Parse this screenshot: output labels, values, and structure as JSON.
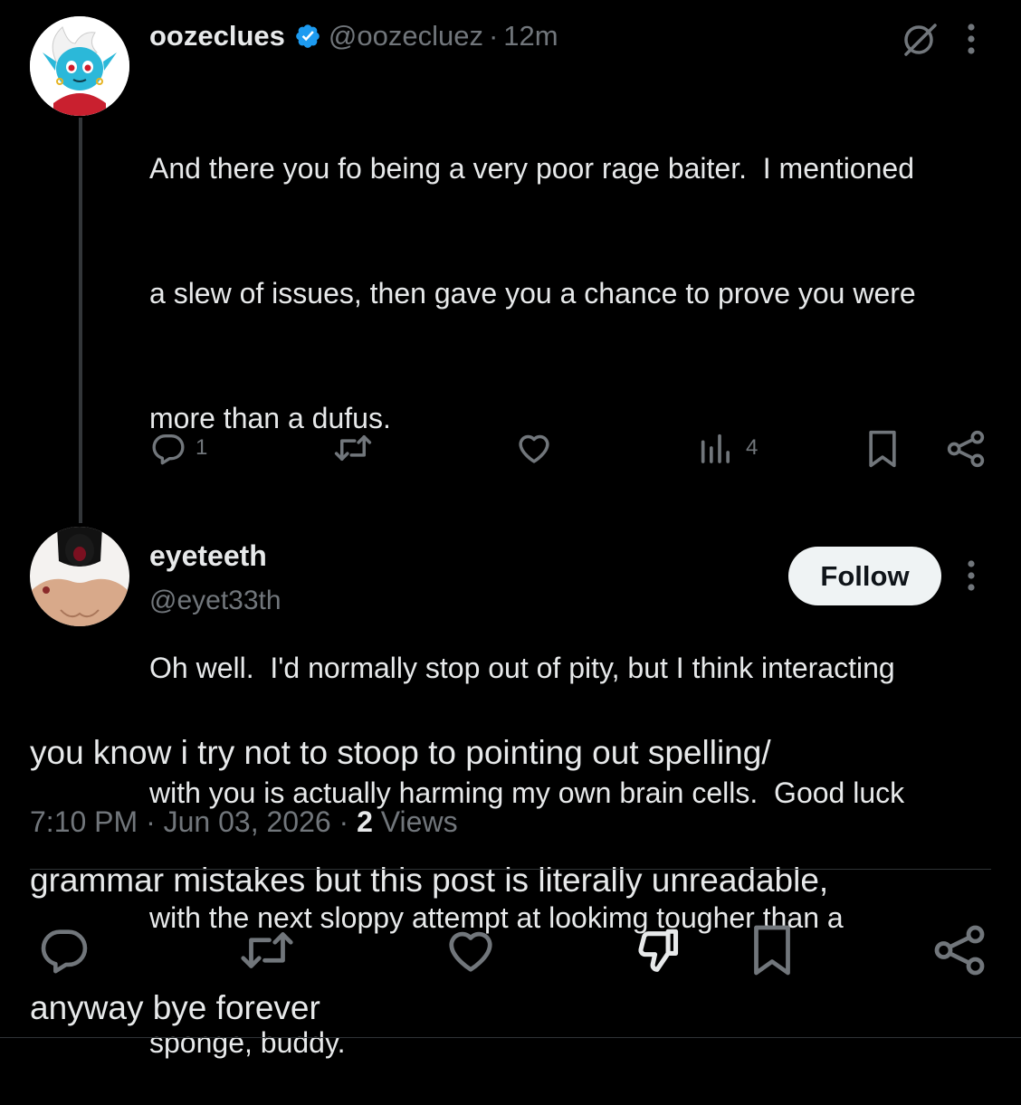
{
  "reply": {
    "display_name": "oozeclues",
    "handle": "@oozecluez",
    "separator": "·",
    "time_ago": "12m",
    "text_lines": [
      "And there you fo being a very poor rage baiter.  I mentioned",
      "a slew of issues, then gave you a chance to prove you were",
      "more than a dufus.",
      "",
      "Oh well.  I'd normally stop out of pity, but I think interacting",
      "with you is actually harming my own brain cells.  Good luck",
      "with the next sloppy attempt at lookimg tougher than a",
      "sponge, buddy."
    ],
    "reply_count": "1",
    "view_count": "4"
  },
  "main_post": {
    "display_name": "eyeteeth",
    "handle": "@eyet33th",
    "follow_label": "Follow",
    "text_lines": [
      "you know i try not to stoop to pointing out spelling/",
      "grammar mistakes but this post is literally unreadable,",
      "anyway bye forever"
    ],
    "time": "7:10 PM",
    "date": "Jun 03, 2026",
    "views_count": "2",
    "views_label": "Views"
  },
  "colors": {
    "background": "#000000",
    "text": "#e7e9ea",
    "muted": "#71767b",
    "verified": "#1d9bf0",
    "follow_bg": "#eff3f4"
  }
}
